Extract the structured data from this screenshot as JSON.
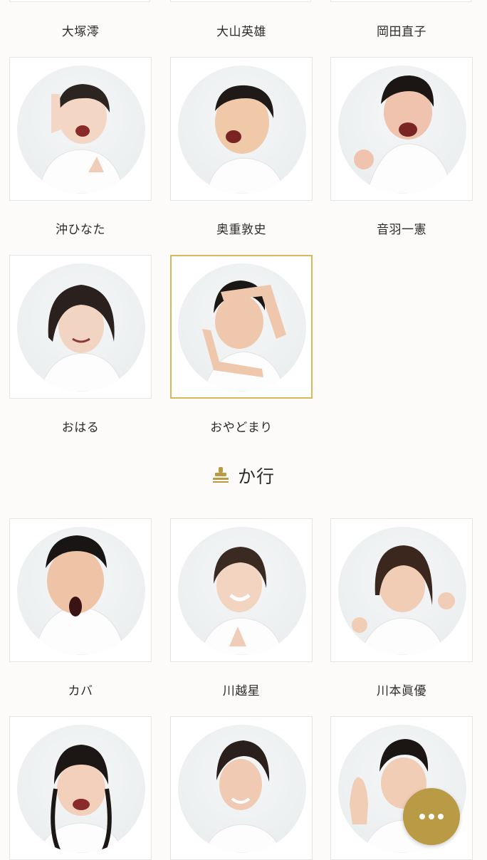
{
  "colors": {
    "accent": "#b99a45",
    "selected_border": "#d6b85c",
    "card_border": "#e4e4e4",
    "background": "#fcfbfa"
  },
  "top_names": [
    "大塚澪",
    "大山英雄",
    "岡田直子"
  ],
  "row_a": [
    {
      "name": "沖ひなた",
      "photo": "performer-photo"
    },
    {
      "name": "奥重敦史",
      "photo": "performer-photo"
    },
    {
      "name": "音羽一憲",
      "photo": "performer-photo"
    }
  ],
  "row_b": [
    {
      "name": "おはる",
      "photo": "performer-photo"
    },
    {
      "name": "おやどまり",
      "photo": "performer-photo",
      "selected": true
    }
  ],
  "section": {
    "title": "か行",
    "icon": "stamp-icon"
  },
  "row_c": [
    {
      "name": "カバ",
      "photo": "performer-photo"
    },
    {
      "name": "川越星",
      "photo": "performer-photo"
    },
    {
      "name": "川本眞優",
      "photo": "performer-photo"
    }
  ],
  "row_d": [
    {
      "photo": "performer-photo"
    },
    {
      "photo": "performer-photo"
    },
    {
      "photo": "performer-photo"
    }
  ],
  "fab": {
    "icon": "more-dots-icon"
  }
}
